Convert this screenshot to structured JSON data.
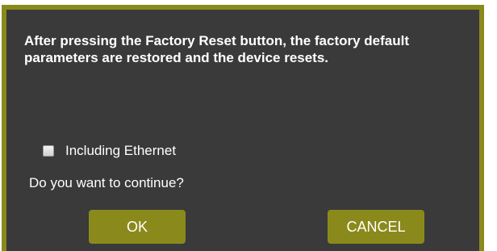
{
  "dialog": {
    "message": "After pressing the Factory Reset button, the factory default parameters are restored and the device resets.",
    "checkbox": {
      "label": "Including Ethernet",
      "checked": false
    },
    "question": "Do you want to continue?",
    "buttons": {
      "ok_label": "OK",
      "cancel_label": "CANCEL"
    }
  },
  "colors": {
    "dialog_background": "#3a3a3a",
    "accent": "#8a8a1c",
    "text": "#ffffff"
  }
}
